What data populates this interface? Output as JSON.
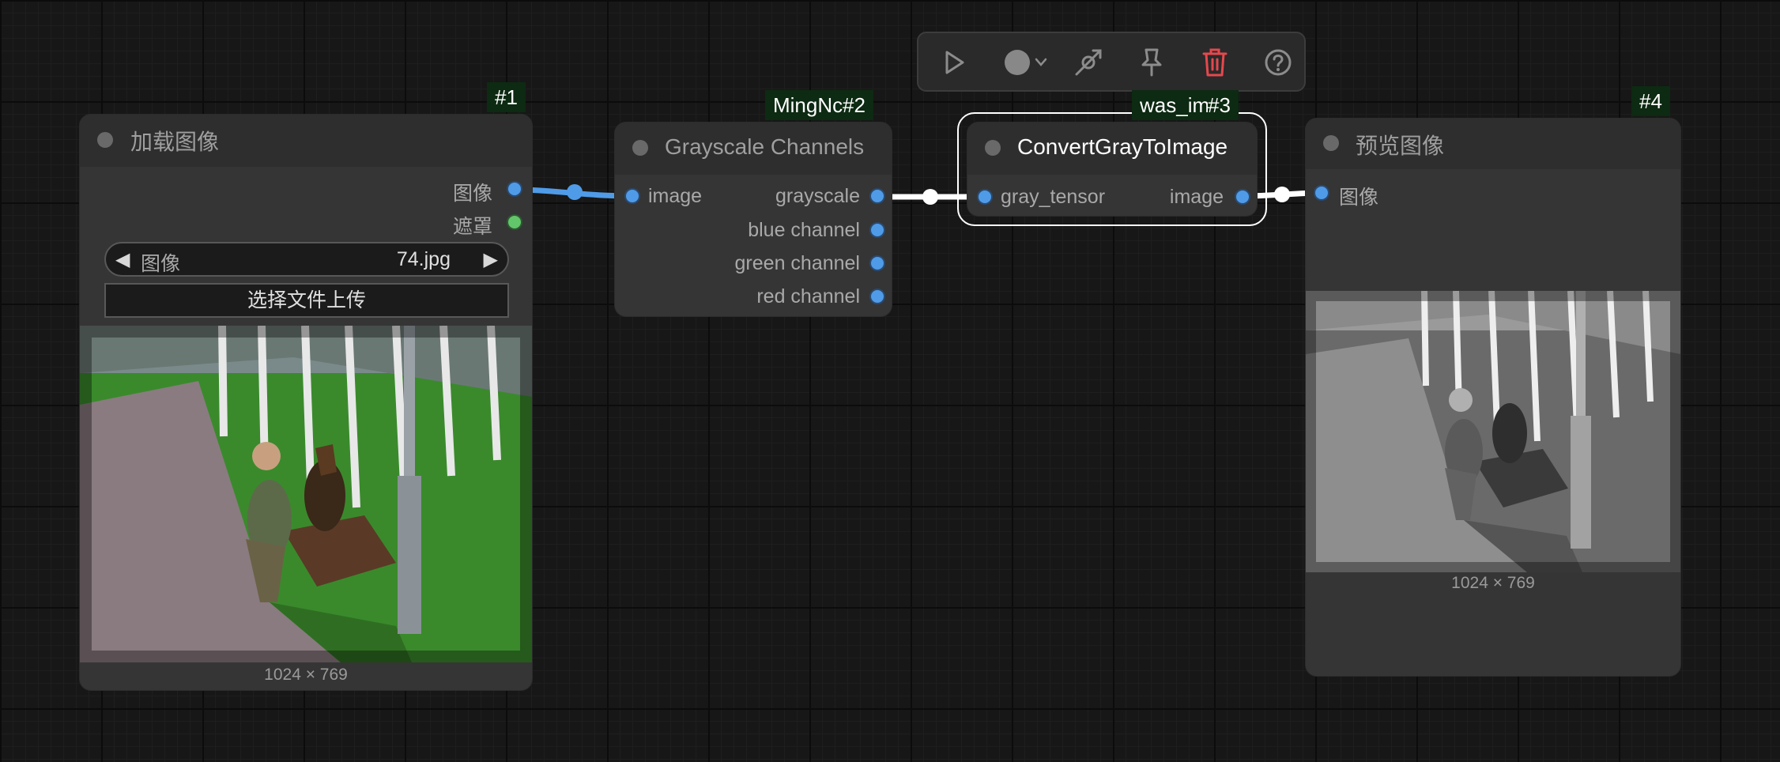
{
  "toolbar": {
    "run_icon": "play-icon",
    "color_icon": "color-circle-icon",
    "bypass_icon": "bypass-icon",
    "pin_icon": "pin-icon",
    "delete_icon": "trash-icon",
    "help_icon": "help-icon",
    "delete_color": "#e5484d"
  },
  "nodes": {
    "load_image": {
      "badge": "#1",
      "title": "加载图像",
      "outputs": [
        "图像",
        "遮罩"
      ],
      "combo": {
        "label": "图像",
        "value": "74.jpg"
      },
      "upload_button": "选择文件上传",
      "image_size": "1024 × 769",
      "image_desc": "color photo: man sitting on a park bench with a dog beside birch trees"
    },
    "grayscale_channels": {
      "badge_prefix": "MingNc",
      "badge": "#2",
      "title": "Grayscale Channels",
      "inputs": [
        "image"
      ],
      "outputs": [
        "grayscale",
        "blue channel",
        "green channel",
        "red channel"
      ]
    },
    "convert_gray": {
      "badge_prefix": "was_im",
      "badge": "#3",
      "title": "ConvertGrayToImage",
      "inputs": [
        "gray_tensor"
      ],
      "outputs": [
        "image"
      ]
    },
    "preview_image": {
      "badge": "#4",
      "title": "预览图像",
      "inputs": [
        "图像"
      ],
      "image_size": "1024 × 769"
    }
  },
  "colors": {
    "canvas": "#171717",
    "node_body": "#353535",
    "node_header": "#2e2e2e",
    "badge_bg": "#0d2a12",
    "link_image": "#4f9be8",
    "link_tensor": "#ffffff",
    "socket_blue": "#4f9be8",
    "socket_green": "#62c66a"
  }
}
